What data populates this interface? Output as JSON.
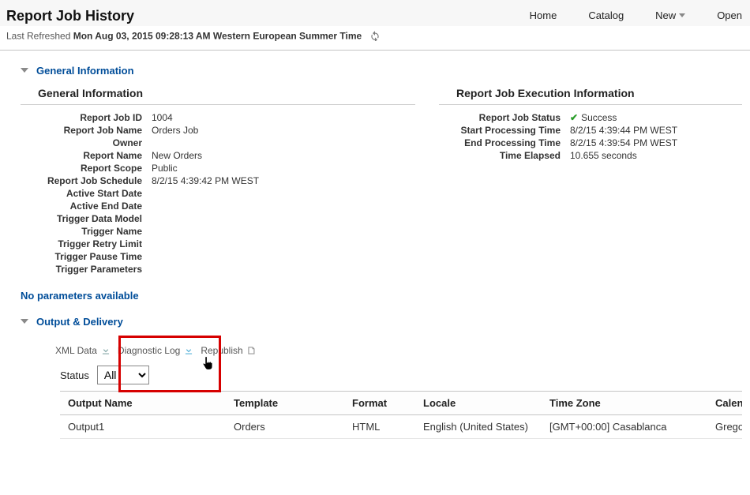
{
  "page_title": "Report Job History",
  "topnav": {
    "home": "Home",
    "catalog": "Catalog",
    "new": "New",
    "open": "Open"
  },
  "refresh": {
    "prefix": "Last Refreshed ",
    "timestamp": "Mon Aug 03, 2015 09:28:13 AM Western European Summer Time"
  },
  "sections": {
    "general": "General Information",
    "output": "Output & Delivery"
  },
  "gen": {
    "heading": "General Information",
    "labels": {
      "id": "Report Job ID",
      "name": "Report Job Name",
      "owner": "Owner",
      "report": "Report Name",
      "scope": "Report Scope",
      "schedule": "Report Job Schedule",
      "astart": "Active Start Date",
      "aend": "Active End Date",
      "tdm": "Trigger Data Model",
      "tname": "Trigger Name",
      "trl": "Trigger Retry Limit",
      "tpt": "Trigger Pause Time",
      "tparams": "Trigger Parameters"
    },
    "values": {
      "id": "1004",
      "name": "Orders Job",
      "owner": "",
      "report": "New Orders",
      "scope": "Public",
      "schedule": "8/2/15 4:39:42 PM WEST",
      "astart": "",
      "aend": "",
      "tdm": "",
      "tname": "",
      "trl": "",
      "tpt": "",
      "tparams": ""
    }
  },
  "exec": {
    "heading": "Report Job Execution Information",
    "labels": {
      "status": "Report Job Status",
      "start": "Start Processing Time",
      "end": "End Processing Time",
      "elapsed": "Time Elapsed"
    },
    "values": {
      "status": "Success",
      "start": "8/2/15 4:39:44 PM WEST",
      "end": "8/2/15 4:39:54 PM WEST",
      "elapsed": "10.655 seconds"
    }
  },
  "noparams": "No parameters available",
  "tools": {
    "xml": "XML Data",
    "diag": "Diagnostic Log",
    "repub": "Republish"
  },
  "status_label": "Status",
  "status_value": "All",
  "grid": {
    "cols": {
      "out": "Output Name",
      "tpl": "Template",
      "fmt": "Format",
      "loc": "Locale",
      "tz": "Time Zone",
      "cal": "Calendar"
    },
    "rows": [
      {
        "out": "Output1",
        "tpl": "Orders",
        "fmt": "HTML",
        "loc": "English (United States)",
        "tz": "[GMT+00:00] Casablanca",
        "cal": "Gregorian"
      }
    ]
  }
}
